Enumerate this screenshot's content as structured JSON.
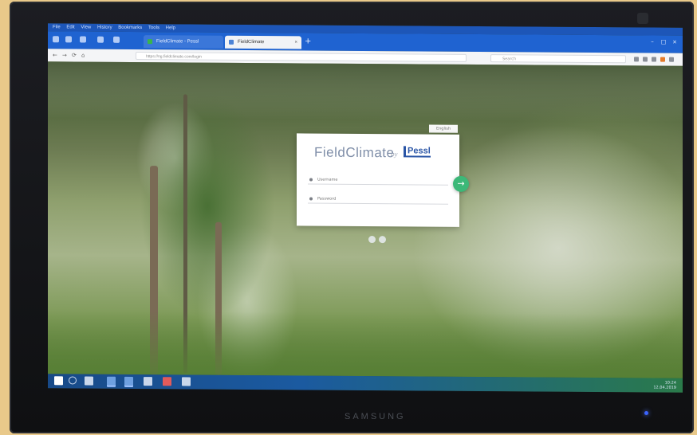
{
  "browser": {
    "menu_items": [
      "File",
      "Edit",
      "View",
      "History",
      "Bookmarks",
      "Tools",
      "Help"
    ],
    "tabs": [
      {
        "label": "FieldClimate - Pessl Instruments",
        "active": false
      },
      {
        "label": "FieldClimate",
        "active": true
      }
    ],
    "new_tab_label": "+",
    "window_controls": [
      "–",
      "□",
      "×"
    ],
    "nav_back": "←",
    "nav_forward": "→",
    "nav_reload": "⟳",
    "nav_home": "⌂",
    "address": "https://ng.fieldclimate.com/login",
    "search_placeholder": "Search"
  },
  "login": {
    "corner_tag": "English",
    "logo_text": "FieldClimate",
    "logo_by": "by",
    "logo_brand": "Pessl",
    "username_placeholder": "Username",
    "password_placeholder": "Password",
    "submit_symbol": "→"
  },
  "taskbar": {
    "time": "10:24",
    "date": "12.04.2019"
  },
  "monitor": {
    "brand": "SAMSUNG"
  },
  "colors": {
    "accent": "#1f63d1",
    "login_button": "#3cb878",
    "brand_blue": "#2a55a6"
  }
}
